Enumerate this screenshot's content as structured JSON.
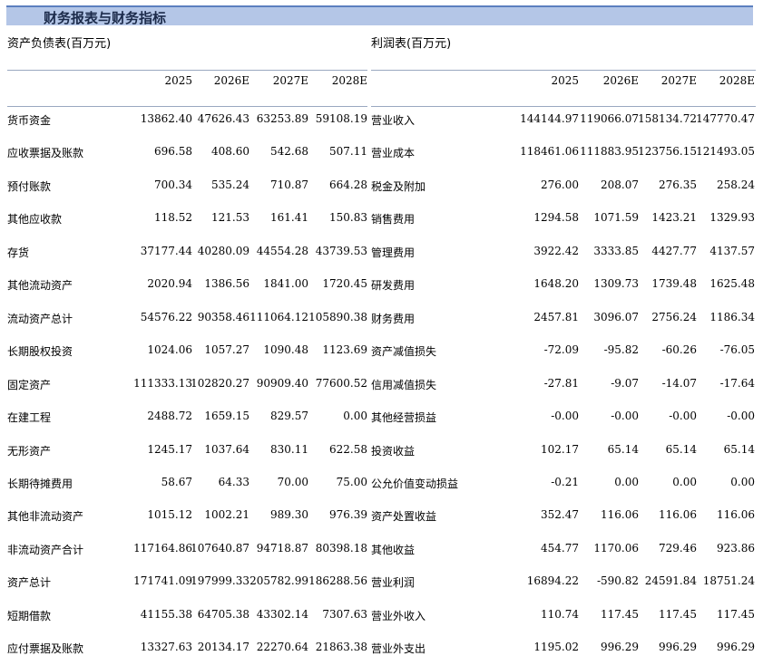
{
  "title": "财务报表与财务指标",
  "balance": {
    "label": "资产负债表(百万元)",
    "years": [
      "2025",
      "2026E",
      "2027E",
      "2028E"
    ],
    "rows": [
      {
        "name": "货币资金",
        "v": [
          "13862.40",
          "47626.43",
          "63253.89",
          "59108.19"
        ]
      },
      {
        "name": "应收票据及账款",
        "v": [
          "696.58",
          "408.60",
          "542.68",
          "507.11"
        ]
      },
      {
        "name": "预付账款",
        "v": [
          "700.34",
          "535.24",
          "710.87",
          "664.28"
        ]
      },
      {
        "name": "其他应收款",
        "v": [
          "118.52",
          "121.53",
          "161.41",
          "150.83"
        ]
      },
      {
        "name": "存货",
        "v": [
          "37177.44",
          "40280.09",
          "44554.28",
          "43739.53"
        ]
      },
      {
        "name": "其他流动资产",
        "v": [
          "2020.94",
          "1386.56",
          "1841.00",
          "1720.45"
        ]
      },
      {
        "name": "流动资产总计",
        "v": [
          "54576.22",
          "90358.46",
          "111064.12",
          "105890.38"
        ]
      },
      {
        "name": "长期股权投资",
        "v": [
          "1024.06",
          "1057.27",
          "1090.48",
          "1123.69"
        ]
      },
      {
        "name": "固定资产",
        "v": [
          "111333.13",
          "102820.27",
          "90909.40",
          "77600.52"
        ]
      },
      {
        "name": "在建工程",
        "v": [
          "2488.72",
          "1659.15",
          "829.57",
          "0.00"
        ]
      },
      {
        "name": "无形资产",
        "v": [
          "1245.17",
          "1037.64",
          "830.11",
          "622.58"
        ]
      },
      {
        "name": "长期待摊费用",
        "v": [
          "58.67",
          "64.33",
          "70.00",
          "75.00"
        ]
      },
      {
        "name": "其他非流动资产",
        "v": [
          "1015.12",
          "1002.21",
          "989.30",
          "976.39"
        ]
      },
      {
        "name": "非流动资产合计",
        "v": [
          "117164.86",
          "107640.87",
          "94718.87",
          "80398.18"
        ]
      },
      {
        "name": "资产总计",
        "v": [
          "171741.09",
          "197999.33",
          "205782.99",
          "186288.56"
        ]
      },
      {
        "name": "短期借款",
        "v": [
          "41155.38",
          "64705.38",
          "43302.14",
          "7307.63"
        ]
      },
      {
        "name": "应付票据及账款",
        "v": [
          "13327.63",
          "20134.17",
          "22270.64",
          "21863.38"
        ]
      }
    ]
  },
  "income": {
    "label": "利润表(百万元)",
    "years": [
      "2025",
      "2026E",
      "2027E",
      "2028E"
    ],
    "rows": [
      {
        "name": "营业收入",
        "v": [
          "144144.97",
          "119066.07",
          "158134.72",
          "147770.47"
        ]
      },
      {
        "name": "营业成本",
        "v": [
          "118461.06",
          "111883.95",
          "123756.15",
          "121493.05"
        ]
      },
      {
        "name": "税金及附加",
        "v": [
          "276.00",
          "208.07",
          "276.35",
          "258.24"
        ]
      },
      {
        "name": "销售费用",
        "v": [
          "1294.58",
          "1071.59",
          "1423.21",
          "1329.93"
        ]
      },
      {
        "name": "管理费用",
        "v": [
          "3922.42",
          "3333.85",
          "4427.77",
          "4137.57"
        ]
      },
      {
        "name": "研发费用",
        "v": [
          "1648.20",
          "1309.73",
          "1739.48",
          "1625.48"
        ]
      },
      {
        "name": "财务费用",
        "v": [
          "2457.81",
          "3096.07",
          "2756.24",
          "1186.34"
        ]
      },
      {
        "name": "资产减值损失",
        "v": [
          "-72.09",
          "-95.82",
          "-60.26",
          "-76.05"
        ]
      },
      {
        "name": "信用减值损失",
        "v": [
          "-27.81",
          "-9.07",
          "-14.07",
          "-17.64"
        ]
      },
      {
        "name": "其他经营损益",
        "v": [
          "-0.00",
          "-0.00",
          "-0.00",
          "-0.00"
        ]
      },
      {
        "name": "投资收益",
        "v": [
          "102.17",
          "65.14",
          "65.14",
          "65.14"
        ]
      },
      {
        "name": "公允价值变动损益",
        "v": [
          "-0.21",
          "0.00",
          "0.00",
          "0.00"
        ]
      },
      {
        "name": "资产处置收益",
        "v": [
          "352.47",
          "116.06",
          "116.06",
          "116.06"
        ]
      },
      {
        "name": "其他收益",
        "v": [
          "454.77",
          "1170.06",
          "729.46",
          "923.86"
        ]
      },
      {
        "name": "营业利润",
        "v": [
          "16894.22",
          "-590.82",
          "24591.84",
          "18751.24"
        ]
      },
      {
        "name": "营业外收入",
        "v": [
          "110.74",
          "117.45",
          "117.45",
          "117.45"
        ]
      },
      {
        "name": "营业外支出",
        "v": [
          "1195.02",
          "996.29",
          "996.29",
          "996.29"
        ]
      }
    ]
  }
}
